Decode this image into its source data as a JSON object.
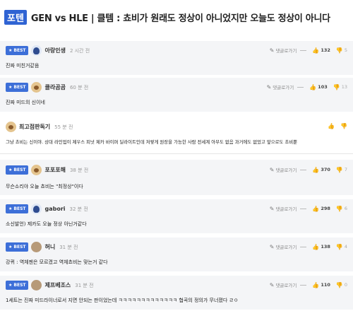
{
  "header": {
    "tag": "포텐",
    "title": "GEN vs HLE | 클템 : 쵸비가 원래도 정상이 아니었지만 오늘도 정상이 아니다"
  },
  "best_label": "BEST",
  "reply_label": "댓글로가기",
  "comments": [
    {
      "best": true,
      "avatar": "penguin-avatar",
      "nick": "아랑인생",
      "time": "2 시간 전",
      "up": "132",
      "down": "5",
      "text": "진짜 미친거같음"
    },
    {
      "best": true,
      "avatar": "dog-avatar",
      "nick": "클라곰곰",
      "time": "60 분 전",
      "up": "103",
      "down": "13",
      "text": "진짜 미드의 신이네"
    },
    {
      "best": false,
      "avatar": "dog-avatar",
      "nick": "최고점판독기",
      "time": "55 분 전",
      "up": "",
      "down": "",
      "text": "그냥 쵸비는 신이야. 상대 라인업이 제우스 피넛 제카 바이퍼 딜라이트인데 저렇게 원장을 가능한 사람 전세계 아무도 없음 과거에도 없었고 앞으로도 쵸비뿐"
    },
    {
      "best": true,
      "avatar": "dog-avatar",
      "nick": "포포포해",
      "time": "38 분 전",
      "up": "370",
      "down": "7",
      "text": "무슨소리야 오늘 쵸비는 \"최정상\"이다"
    },
    {
      "best": true,
      "avatar": "penguin-avatar",
      "nick": "gabori",
      "time": "32 분 전",
      "up": "298",
      "down": "6",
      "text": "소신발언) 제카도 오늘 정상 아닌거같다"
    },
    {
      "best": true,
      "avatar": "ball-avatar",
      "nick": "허니",
      "time": "31 분 전",
      "up": "138",
      "down": "4",
      "text": "강퀴 : 역체젠은 모르겠고 역체쵸비는 맞는거 같다"
    },
    {
      "best": true,
      "avatar": "ball-avatar",
      "nick": "제프베조스",
      "time": "31 분 전",
      "up": "110",
      "down": "0",
      "text": "1세트는 진짜 미드라이너로서 지면 안되는 판이었는데 ㅋㅋㅋㅋㅋㅋㅋㅋㅋㅋㅋㅋㅋ 협곡의 정의가 무너졌다 ㄹㅇ"
    }
  ],
  "colors": {
    "accent": "#2f63d3",
    "best_badge": "#3d6fd8",
    "shaded_bg": "#f4f5f7"
  }
}
